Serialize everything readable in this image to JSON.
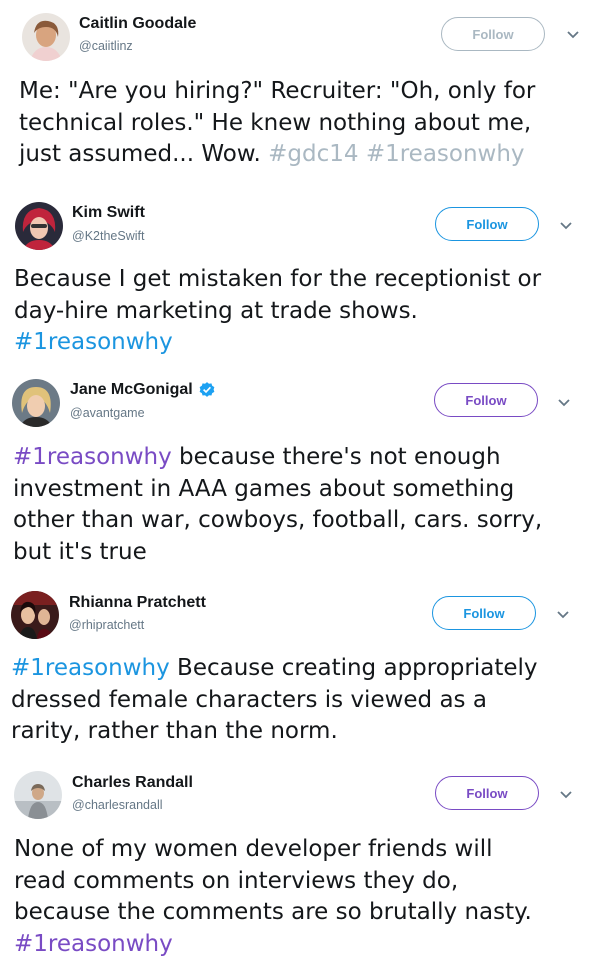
{
  "tweets": [
    {
      "name": "Caitlin Goodale",
      "handle": "@caiitlinz",
      "follow_label": "Follow",
      "follow_color": "#aab8c2",
      "hashtag_color": "#aab8c2",
      "lines": [
        "Me: \"Are you hiring?\" Recruiter: \"Oh, only for",
        "technical roles.\" He knew nothing about me,",
        "just assumed... Wow. "
      ],
      "hashtags": [
        "#gdc14",
        "#1reasonwhy"
      ]
    },
    {
      "name": "Kim Swift",
      "handle": "@K2theSwift",
      "follow_label": "Follow",
      "follow_color": "#1b95e0",
      "hashtag_color": "#1b95e0",
      "lines": [
        "Because I get mistaken for the receptionist or",
        "day-hire marketing at trade shows."
      ],
      "hashtag": "#1reasonwhy"
    },
    {
      "name": "Jane McGonigal",
      "handle": "@avantgame",
      "follow_label": "Follow",
      "follow_color": "#794bc4",
      "hashtag_color": "#794bc4",
      "verified": true,
      "hashtag": "#1reasonwhy",
      "lines": [
        " because there's not enough",
        "investment in AAA games about something",
        "other than war, cowboys, football, cars. sorry,",
        "but it's true"
      ]
    },
    {
      "name": "Rhianna Pratchett",
      "handle": "@rhipratchett",
      "follow_label": "Follow",
      "follow_color": "#1b95e0",
      "hashtag_color": "#1b95e0",
      "hashtag": "#1reasonwhy",
      "lines": [
        " Because creating appropriately",
        "dressed female characters is viewed as a",
        "rarity, rather than the norm."
      ]
    },
    {
      "name": "Charles Randall",
      "handle": "@charlesrandall",
      "follow_label": "Follow",
      "follow_color": "#794bc4",
      "hashtag_color": "#794bc4",
      "lines": [
        "None of my women developer friends will",
        "read comments on interviews they do,",
        "because the comments are so brutally nasty."
      ],
      "hashtag": "#1reasonwhy"
    }
  ]
}
